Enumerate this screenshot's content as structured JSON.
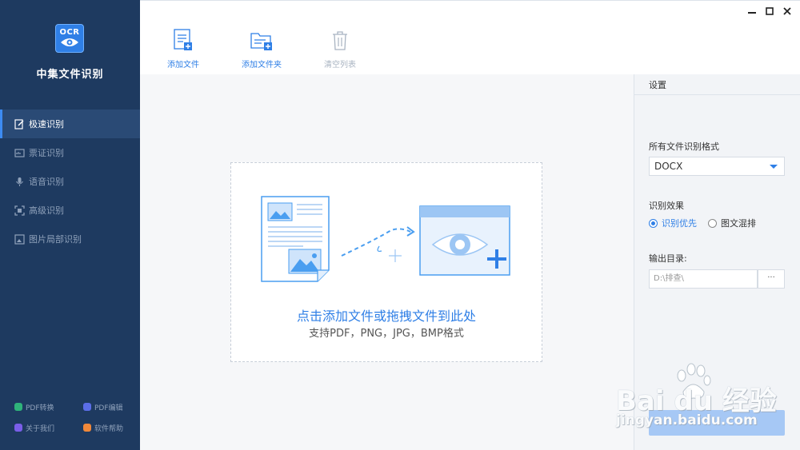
{
  "app": {
    "logo_text": "OCR",
    "name": "中集文件识别"
  },
  "sidebar": {
    "items": [
      {
        "label": "极速识别",
        "icon": "edit-doc-icon",
        "active": true
      },
      {
        "label": "票证识别",
        "icon": "card-icon",
        "active": false
      },
      {
        "label": "语音识别",
        "icon": "mic-icon",
        "active": false
      },
      {
        "label": "高级识别",
        "icon": "scan-icon",
        "active": false
      },
      {
        "label": "图片局部识别",
        "icon": "image-crop-icon",
        "active": false
      }
    ],
    "footer": [
      {
        "label": "PDF转换",
        "icon": "pdf-convert-icon",
        "color": "#2fb37a"
      },
      {
        "label": "PDF编辑",
        "icon": "pdf-edit-icon",
        "color": "#5b6ee8"
      },
      {
        "label": "关于我们",
        "icon": "about-icon",
        "color": "#7a5ee8"
      },
      {
        "label": "软件帮助",
        "icon": "help-icon",
        "color": "#f0883a"
      }
    ]
  },
  "toolbar": {
    "add_file": "添加文件",
    "add_folder": "添加文件夹",
    "clear_list": "清空列表"
  },
  "dropzone": {
    "title": "点击添加文件或拖拽文件到此处",
    "subtitle": "支持PDF，PNG，JPG，BMP格式"
  },
  "settings": {
    "header": "设置",
    "format_label": "所有文件识别格式",
    "format_value": "DOCX",
    "effect_label": "识别效果",
    "effect_options": [
      {
        "label": "识别优先",
        "checked": true
      },
      {
        "label": "图文混排",
        "checked": false
      }
    ],
    "output_label": "输出目录:",
    "output_path": "D:\\排查\\",
    "browse_label": "···"
  },
  "watermark": {
    "brand": "Bai du 经验",
    "url": "jingyan.baidu.com"
  },
  "colors": {
    "sidebar_bg": "#1e3a60",
    "accent": "#2f7fe6",
    "start_button": "#a6c8f5"
  }
}
